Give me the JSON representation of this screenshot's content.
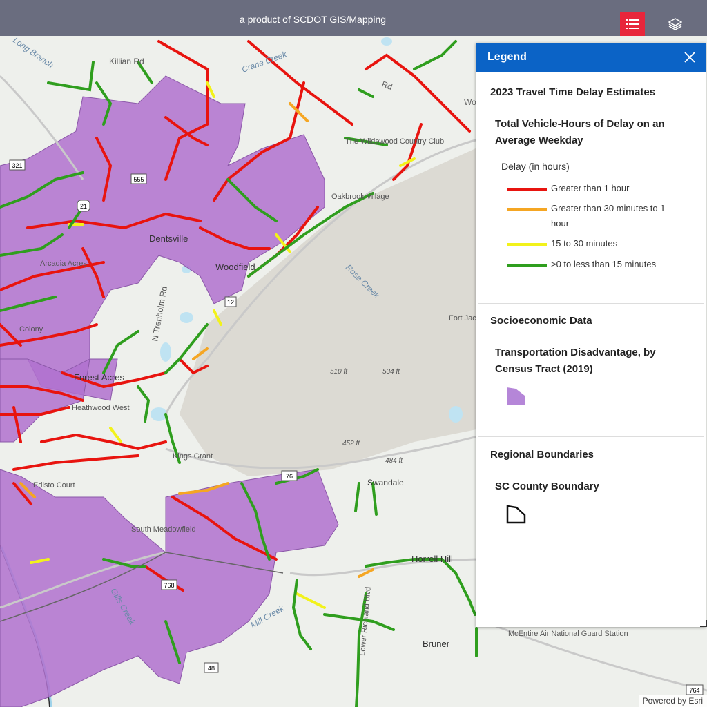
{
  "header": {
    "title": "a product of SCDOT GIS/Mapping",
    "legend_button": "legend-list-icon",
    "layers_button": "layers-stack-icon"
  },
  "legend": {
    "title": "Legend",
    "close_icon": "close-icon",
    "section1": {
      "title": "2023 Travel Time Delay Estimates",
      "subtitle": "Total Vehicle-Hours of Delay on an Average Weekday",
      "field_label": "Delay (in hours)",
      "items": [
        {
          "label": "Greater than 1 hour",
          "color": "#e8140f"
        },
        {
          "label": "Greater than 30 minutes to 1 hour",
          "color": "#f5a623"
        },
        {
          "label": "15 to 30 minutes",
          "color": "#f2f21b"
        },
        {
          "label": ">0 to less than 15 minutes",
          "color": "#2f9e1e"
        }
      ]
    },
    "section2": {
      "title": "Socioeconomic Data",
      "subtitle": "Transportation Disadvantage, by Census Tract (2019)",
      "swatch_color": "#b586d8"
    },
    "section3": {
      "title": "Regional Boundaries",
      "subtitle": "SC County Boundary"
    }
  },
  "map": {
    "place_labels": {
      "long_branch": "Long Branch",
      "killian_rd": "Killian Rd",
      "crane_creek": "Crane Creek",
      "wildewood": "The Wildewood Country Club",
      "oakbrook": "Oakbrook Village",
      "dentsville": "Dentsville",
      "woodfield": "Woodfield",
      "arcadia": "Arcadia Acres",
      "rose_creek": "Rose Creek",
      "trenholm": "N Trenholm Rd",
      "fort_jackson": "Fort Jac",
      "colony": "Colony",
      "forest_acres": "Forest Acres",
      "heathwood": "Heathwood West",
      "kings_grant": "Kings Grant",
      "swandale": "Swandale",
      "edisto_court": "Edisto Court",
      "south_meadowfield": "South Meadowfield",
      "horrell_hill": "Horrell Hill",
      "bruner": "Bruner",
      "mcentire": "McEntire Air National Guard Station",
      "lower_richland": "Lower Richland Blvd",
      "mill_creek": "Mill Creek",
      "gills_creek": "Gills Creek",
      "elev_510": "510 ft",
      "elev_534": "534 ft",
      "elev_452": "452 ft",
      "elev_484": "484 ft",
      "rd_top": "Rd",
      "wo": "Wo"
    },
    "shields": {
      "us321": "321",
      "us21": "21",
      "sc555": "555",
      "sc12": "12",
      "sc768": "768",
      "sc48": "48",
      "sc764": "764",
      "us76": "76"
    },
    "attribution": "Powered by Esri"
  }
}
